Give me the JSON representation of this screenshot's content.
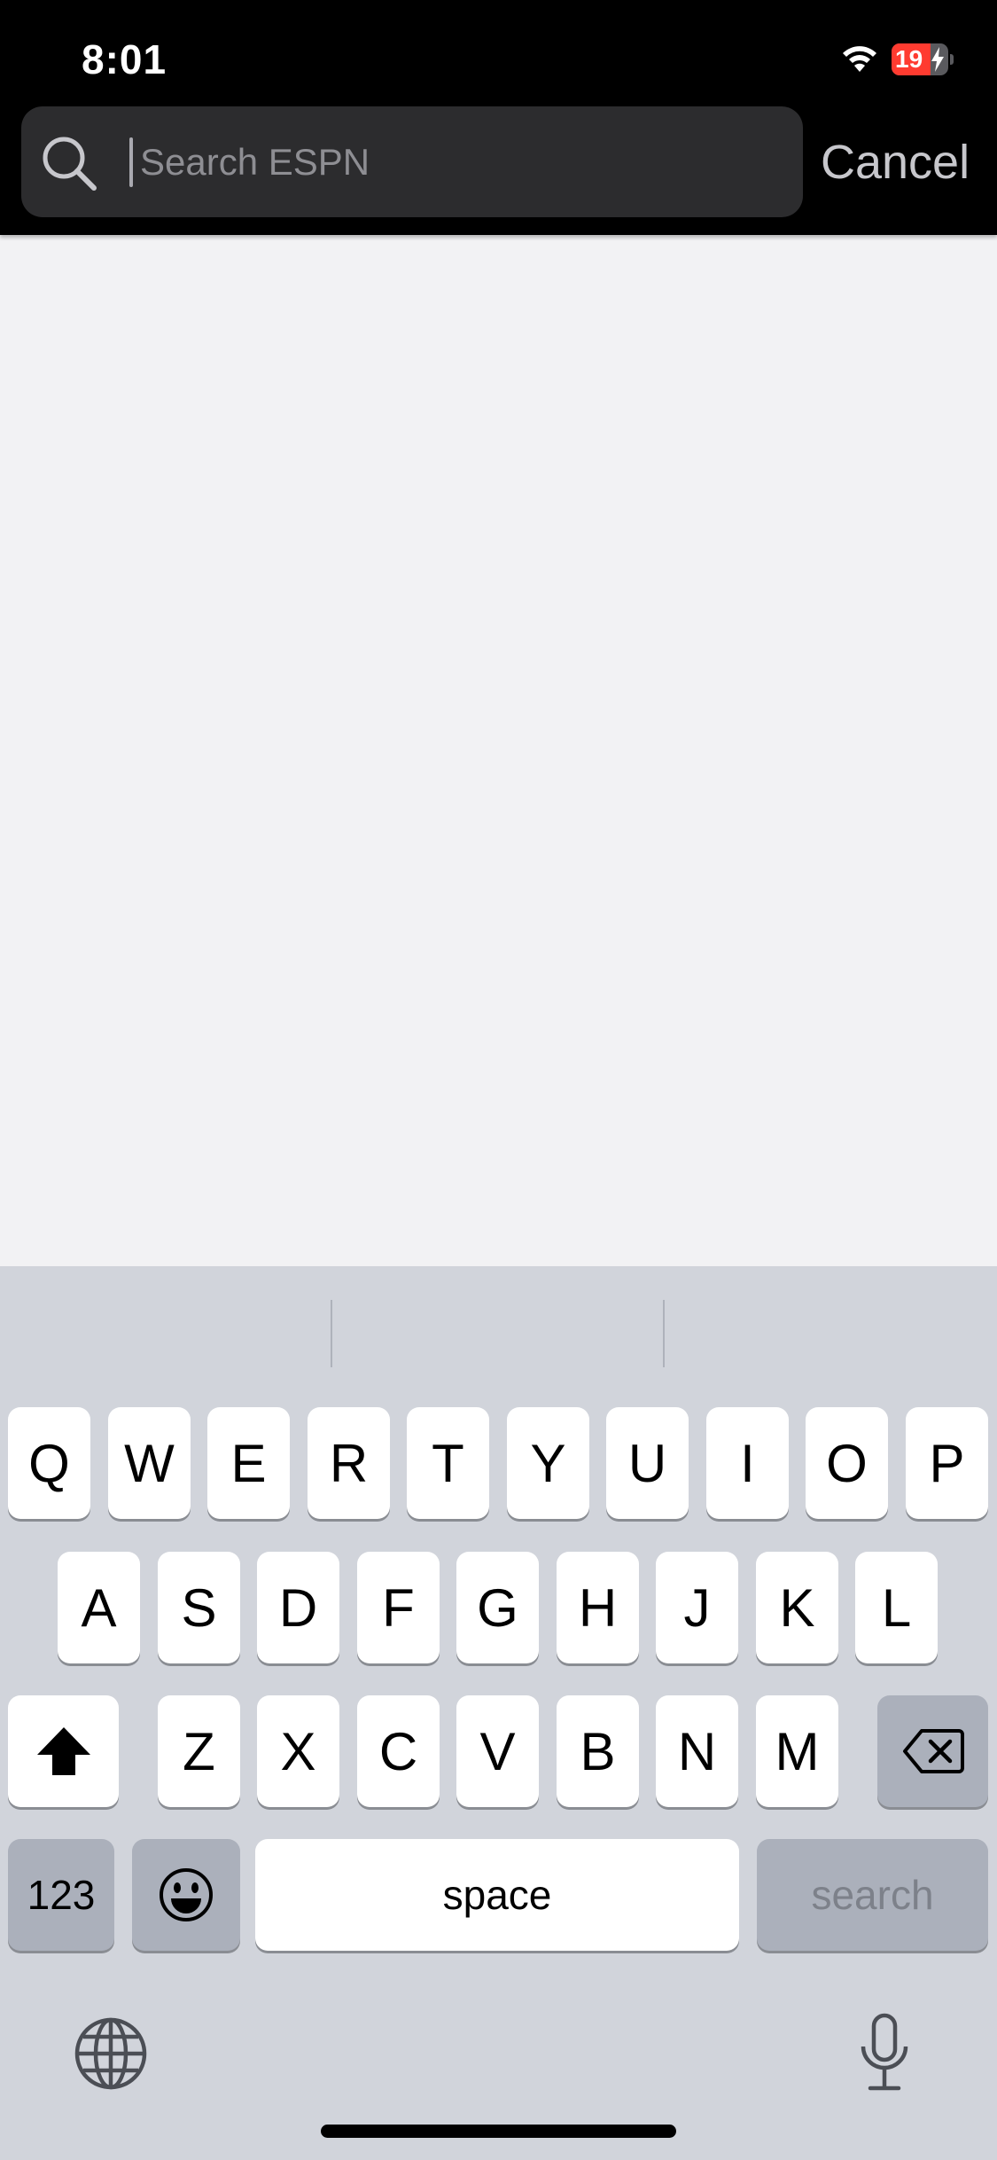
{
  "status_bar": {
    "time": "8:01",
    "battery_level": "19",
    "battery_color": "#ff3b30",
    "icons": [
      "wifi-icon",
      "battery-icon",
      "charging-bolt-icon"
    ]
  },
  "search": {
    "placeholder": "Search ESPN",
    "value": "",
    "cancel_label": "Cancel",
    "icon": "search-icon"
  },
  "keyboard": {
    "row1": [
      "Q",
      "W",
      "E",
      "R",
      "T",
      "Y",
      "U",
      "I",
      "O",
      "P"
    ],
    "row2": [
      "A",
      "S",
      "D",
      "F",
      "G",
      "H",
      "J",
      "K",
      "L"
    ],
    "row3": [
      "Z",
      "X",
      "C",
      "V",
      "B",
      "N",
      "M"
    ],
    "numbers_label": "123",
    "space_label": "space",
    "action_label": "search",
    "icons": [
      "shift-icon",
      "delete-icon",
      "emoji-icon",
      "globe-icon",
      "microphone-icon"
    ]
  }
}
